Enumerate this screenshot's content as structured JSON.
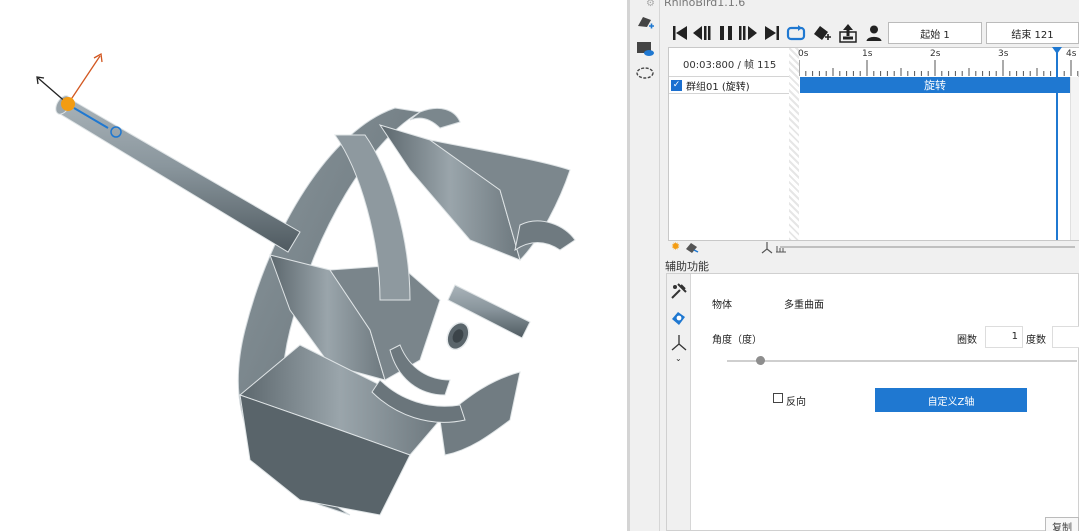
{
  "app": {
    "title": "RhinoBird1.1.6"
  },
  "toolbar": {
    "start_label": "起始 1",
    "end_label": "结束 121"
  },
  "timeline": {
    "time_readout": "00:03:800 / 帧 115",
    "ticks": [
      "0s",
      "1s",
      "2s",
      "3s",
      "4s"
    ],
    "group_label": "群组01 (旋转)",
    "track_label": "旋转"
  },
  "assist": {
    "title": "辅助功能",
    "object_label": "物体",
    "object_value": "多重曲面",
    "angle_label": "角度（度）",
    "turns_label": "圈数",
    "turns_value": "1",
    "degree_label": "度数",
    "reverse_label": "反向",
    "custom_axis_label": "自定义Z轴",
    "copy_label": "复制"
  },
  "colors": {
    "accent": "#1f78d1",
    "model": "#7d8a91",
    "axis_x": "#222222",
    "axis_y": "#d2561f",
    "origin": "#f39c12"
  }
}
